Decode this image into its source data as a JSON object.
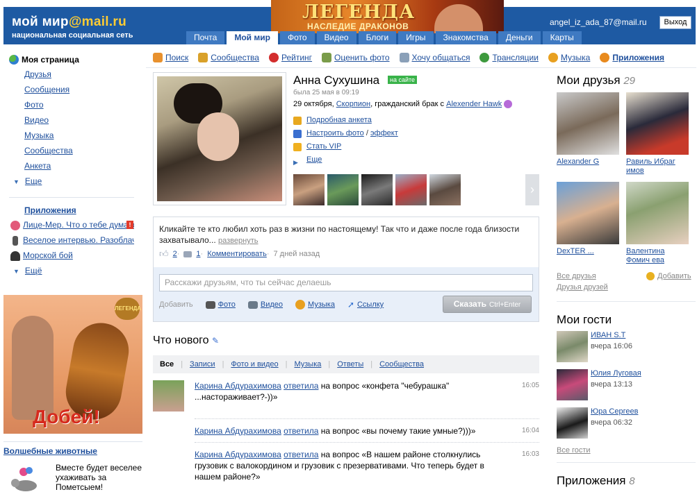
{
  "header": {
    "logo_main": "мой мир",
    "logo_domain": "@mail.ru",
    "logo_sub": "национальная социальная сеть",
    "banner_title": "ЛЕГЕНДА",
    "banner_subtitle": "НАСЛЕДИЕ ДРАКОНОВ",
    "user_email": "angel_iz_ada_87@mail.ru",
    "logout_label": "Выход",
    "tabs": [
      "Почта",
      "Мой мир",
      "Фото",
      "Видео",
      "Блоги",
      "Игры",
      "Знакомства",
      "Деньги",
      "Карты"
    ],
    "active_tab": "Мой мир"
  },
  "left_menu": {
    "my_page": "Моя страница",
    "items": [
      "Друзья",
      "Сообщения",
      "Фото",
      "Видео",
      "Музыка",
      "Сообщества",
      "Анкета"
    ],
    "more": "Еще",
    "apps_title": "Приложения",
    "apps": [
      "Лице-Мер. Что о тебе думают",
      "Веселое интервью. Разоблачение",
      "Морской бой"
    ],
    "apps_more": "Ещё"
  },
  "ad": {
    "word": "Добей!",
    "badge": "ЛЕГЕНДА"
  },
  "pets": {
    "title": "Волшебные животные",
    "text": "Вместе будет веселее ухаживать за Пометсыем!"
  },
  "main_nav": [
    {
      "label": "Поиск",
      "color": "#e8912e"
    },
    {
      "label": "Сообщества",
      "color": "#d9a12a"
    },
    {
      "label": "Рейтинг",
      "color": "#d32d2d"
    },
    {
      "label": "Оценить фото",
      "color": "#7a9c4a"
    },
    {
      "label": "Хочу общаться",
      "color": "#8aa0b8"
    },
    {
      "label": "Трансляции",
      "color": "#3e9a3e"
    },
    {
      "label": "Музыка",
      "color": "#e8a020"
    },
    {
      "label": "Приложения",
      "color": "#e88a1e"
    }
  ],
  "profile": {
    "name": "Анна Сухушина",
    "online": "на сайте",
    "last_seen": "была 25 мая в 09:19",
    "birthday": "29 октября,",
    "zodiac": "Скорпион",
    "marital": ", гражданский брак с",
    "partner": "Alexender Hawk",
    "links": {
      "detailed": "Подробная анкета",
      "photo_setup": "Настроить фото",
      "effect": "эффект",
      "vip": "Стать VIP",
      "more": "Еще"
    }
  },
  "status": {
    "text": "Кликайте те кто любил хоть раз в жизни по настоящему! Так что и даже после года близости захватывало...",
    "expand": "развернуть",
    "likes": "2",
    "comments": "1",
    "comment_label": "Комментировать",
    "ago": "7 дней назад"
  },
  "compose": {
    "placeholder": "Расскажи друзьям, что ты сейчас делаешь",
    "add_label": "Добавить",
    "photo": "Фото",
    "video": "Видео",
    "music": "Музыка",
    "link": "Ссылку",
    "say": "Сказать",
    "hotkey": "Ctrl+Enter"
  },
  "whats_new": {
    "title": "Что нового",
    "tabs": [
      "Все",
      "Записи",
      "Фото и видео",
      "Музыка",
      "Ответы",
      "Сообщества"
    ],
    "items": [
      {
        "author": "Карина Абдурахимова",
        "action": "ответила",
        "text": "на вопрос «конфета \"чебурашка\" ...настораживает?-))»",
        "time": "16:05"
      },
      {
        "author": "Карина Абдурахимова",
        "action": "ответила",
        "text": "на вопрос «вы почему такие умные?)))»",
        "time": "16:04"
      },
      {
        "author": "Карина Абдурахимова",
        "action": "ответила",
        "text": "на вопрос «В нашем районе столкнулись грузовик с валокордином и грузовик с презервативами. Что теперь будет в нашем районе?»",
        "time": "16:03"
      }
    ]
  },
  "friends": {
    "title": "Мои друзья",
    "count": "29",
    "list": [
      "Alexander G",
      "Равиль Ибраг имов",
      "DexTER ...",
      "Валентина Фомич ева"
    ],
    "all": "Все друзья",
    "fof": "Друзья друзей",
    "add": "Добавить"
  },
  "guests": {
    "title": "Мои гости",
    "list": [
      {
        "name": "ИВАН S.T",
        "time": "вчера 16:06"
      },
      {
        "name": "Юлия Луговая",
        "time": "вчера 13:13"
      },
      {
        "name": "Юра Сергеев",
        "time": "вчера 06:32"
      }
    ],
    "all": "Все гости"
  },
  "apps": {
    "title": "Приложения",
    "count": "8"
  }
}
